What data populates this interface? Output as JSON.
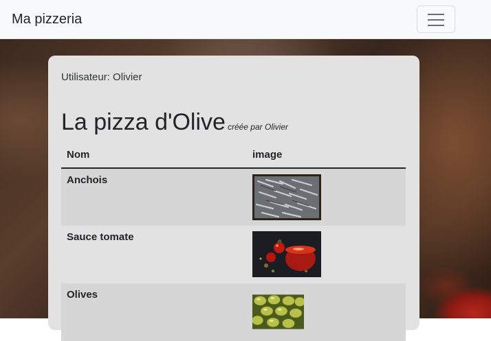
{
  "navbar": {
    "brand": "Ma pizzeria",
    "toggler": "menu-icon"
  },
  "user": {
    "label": "Utilisateur: Olivier"
  },
  "pizza": {
    "name": "La pizza d'Olive",
    "author": "créée par Olivier"
  },
  "table": {
    "headers": [
      "Nom",
      "image"
    ],
    "rows": [
      {
        "name": "Anchois",
        "image": "anchovies-image"
      },
      {
        "name": "Sauce tomate",
        "image": "tomato-sauce-image"
      },
      {
        "name": "Olives",
        "image": "olives-image"
      }
    ]
  }
}
